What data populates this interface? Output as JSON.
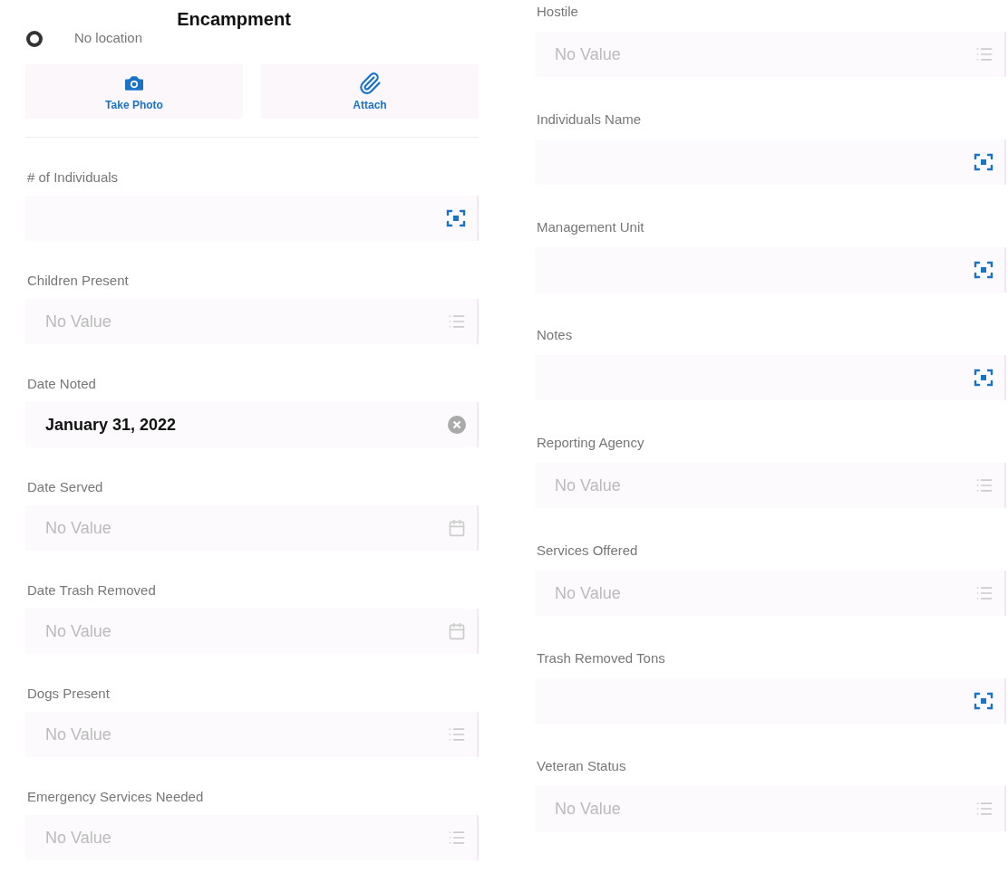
{
  "header": {
    "title": "Encampment",
    "location": "No location"
  },
  "attachments": [
    {
      "label": "Take Photo",
      "kind": "camera"
    },
    {
      "label": "Attach",
      "kind": "clip"
    }
  ],
  "left_fields": [
    {
      "label": "# of Individuals",
      "kind": "scan"
    },
    {
      "label": "Children Present",
      "kind": "list",
      "placeholder": "No Value"
    },
    {
      "label": "Date Noted",
      "kind": "clear",
      "value": "January 31, 2022"
    },
    {
      "label": "Date Served",
      "kind": "date",
      "placeholder": "No Value"
    },
    {
      "label": "Date Trash Removed",
      "kind": "date",
      "placeholder": "No Value"
    },
    {
      "label": "Dogs Present",
      "kind": "list",
      "placeholder": "No Value"
    },
    {
      "label": "Emergency Services Needed",
      "kind": "list",
      "placeholder": "No Value"
    }
  ],
  "right_fields": [
    {
      "label": "Hostile",
      "kind": "list",
      "placeholder": "No Value"
    },
    {
      "label": "Individuals Name",
      "kind": "scan"
    },
    {
      "label": "Management Unit",
      "kind": "scan"
    },
    {
      "label": "Notes",
      "kind": "scan"
    },
    {
      "label": "Reporting Agency",
      "kind": "list",
      "placeholder": "No Value"
    },
    {
      "label": "Services Offered",
      "kind": "list",
      "placeholder": "No Value"
    },
    {
      "label": "Trash Removed Tons",
      "kind": "scan"
    },
    {
      "label": "Veteran Status",
      "kind": "list",
      "placeholder": "No Value"
    }
  ]
}
